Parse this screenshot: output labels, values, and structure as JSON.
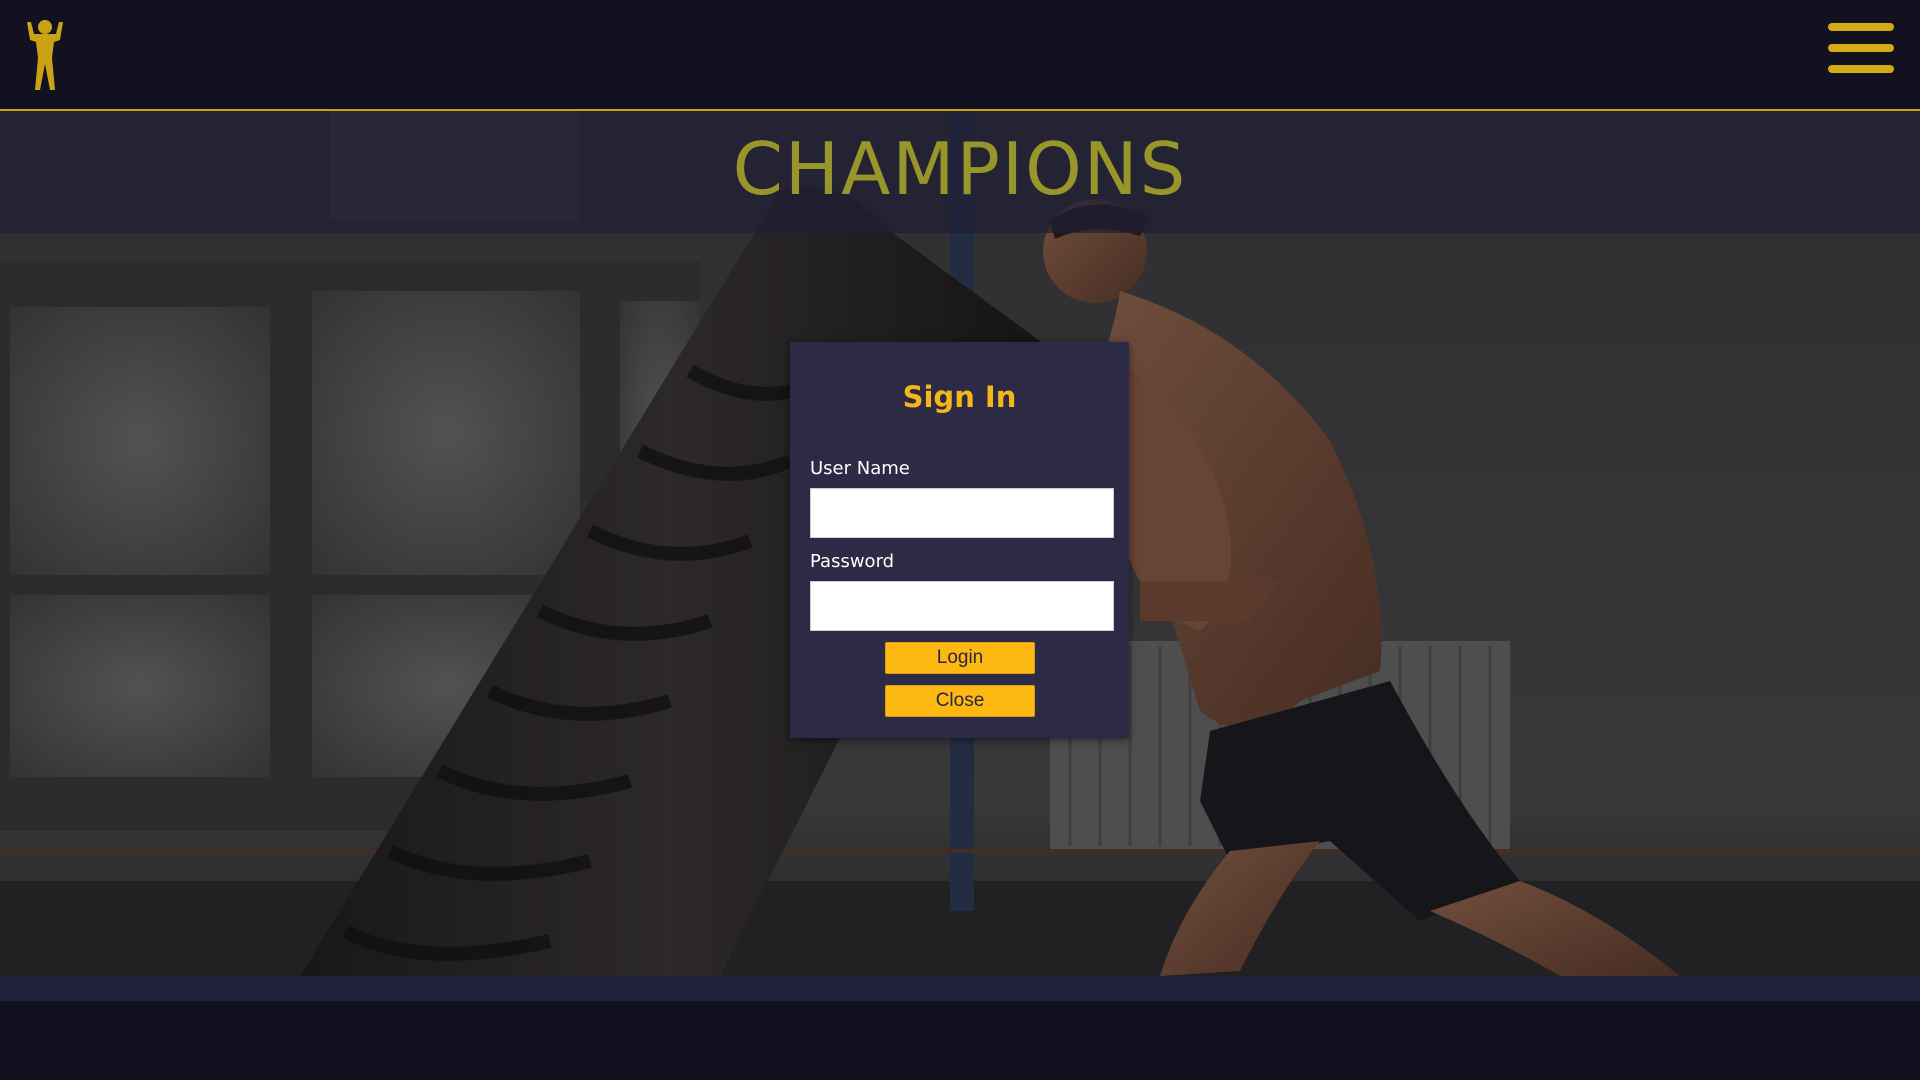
{
  "header": {
    "logo_icon": "weightlifter-icon",
    "menu_icon": "hamburger-menu-icon"
  },
  "hero": {
    "brand_title": "CHAMPIONS"
  },
  "signin": {
    "title": "Sign In",
    "username_label": "User Name",
    "username_value": "",
    "password_label": "Password",
    "password_value": "",
    "login_label": "Login",
    "close_label": "Close"
  },
  "colors": {
    "accent": "#fdb812",
    "brand_gold": "#d4ab16",
    "title_olive": "#98962a",
    "panel": "#2c2a44",
    "background": "#12111f"
  }
}
